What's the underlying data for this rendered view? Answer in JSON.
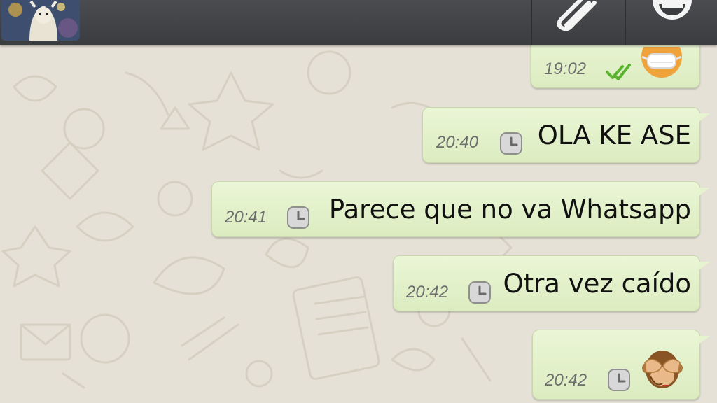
{
  "contact": {
    "avatar_icon": "contact-avatar"
  },
  "toolbar": {
    "attach_icon": "paperclip-icon",
    "emoji_icon": "smiley-icon",
    "bar_color": "#3f4145"
  },
  "messages": [
    {
      "time": "19:02",
      "status_icon": "double-check-icon",
      "emoji": "mask-face",
      "text": ""
    },
    {
      "time": "20:40",
      "status_icon": "clock-icon",
      "text": "OLA KE ASE"
    },
    {
      "time": "20:41",
      "status_icon": "clock-icon",
      "text": "Parece que no va Whatsapp"
    },
    {
      "time": "20:42",
      "status_icon": "clock-icon",
      "text": "Otra vez caído"
    },
    {
      "time": "20:42",
      "status_icon": "clock-icon",
      "emoji": "see-no-evil-monkey",
      "text": ""
    }
  ],
  "colors": {
    "bubble": "#e2f0c9",
    "read_check": "#5cb531",
    "wallpaper": "#e6e1d6"
  }
}
